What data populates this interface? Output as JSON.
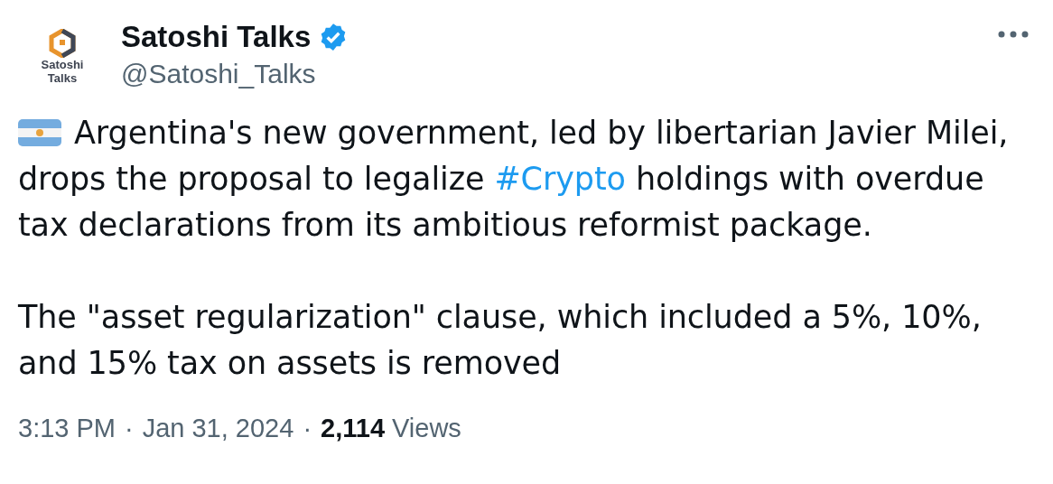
{
  "author": {
    "avatar_text": [
      "Satoshi",
      "Talks"
    ],
    "name": "Satoshi Talks",
    "verified": true,
    "handle": "@Satoshi_Talks"
  },
  "more_menu": true,
  "body": [
    [
      {
        "kind": "text",
        "text": "Argentina's new government, led by libertarian Javier Milei, drops the proposal to legalize "
      },
      {
        "kind": "hashtag",
        "text": "#Crypto"
      },
      {
        "kind": "text",
        "text": " holdings with overdue tax declarations from its ambitious reformist package."
      }
    ],
    [
      {
        "kind": "text",
        "text": "The \"asset regularization\" clause, which included a 5%, 10%, and 15% tax on assets is removed"
      }
    ]
  ],
  "meta": {
    "time": "3:13 PM",
    "separator": "·",
    "date": "Jan 31, 2024",
    "views_count": "2,114",
    "views_label": "Views"
  }
}
